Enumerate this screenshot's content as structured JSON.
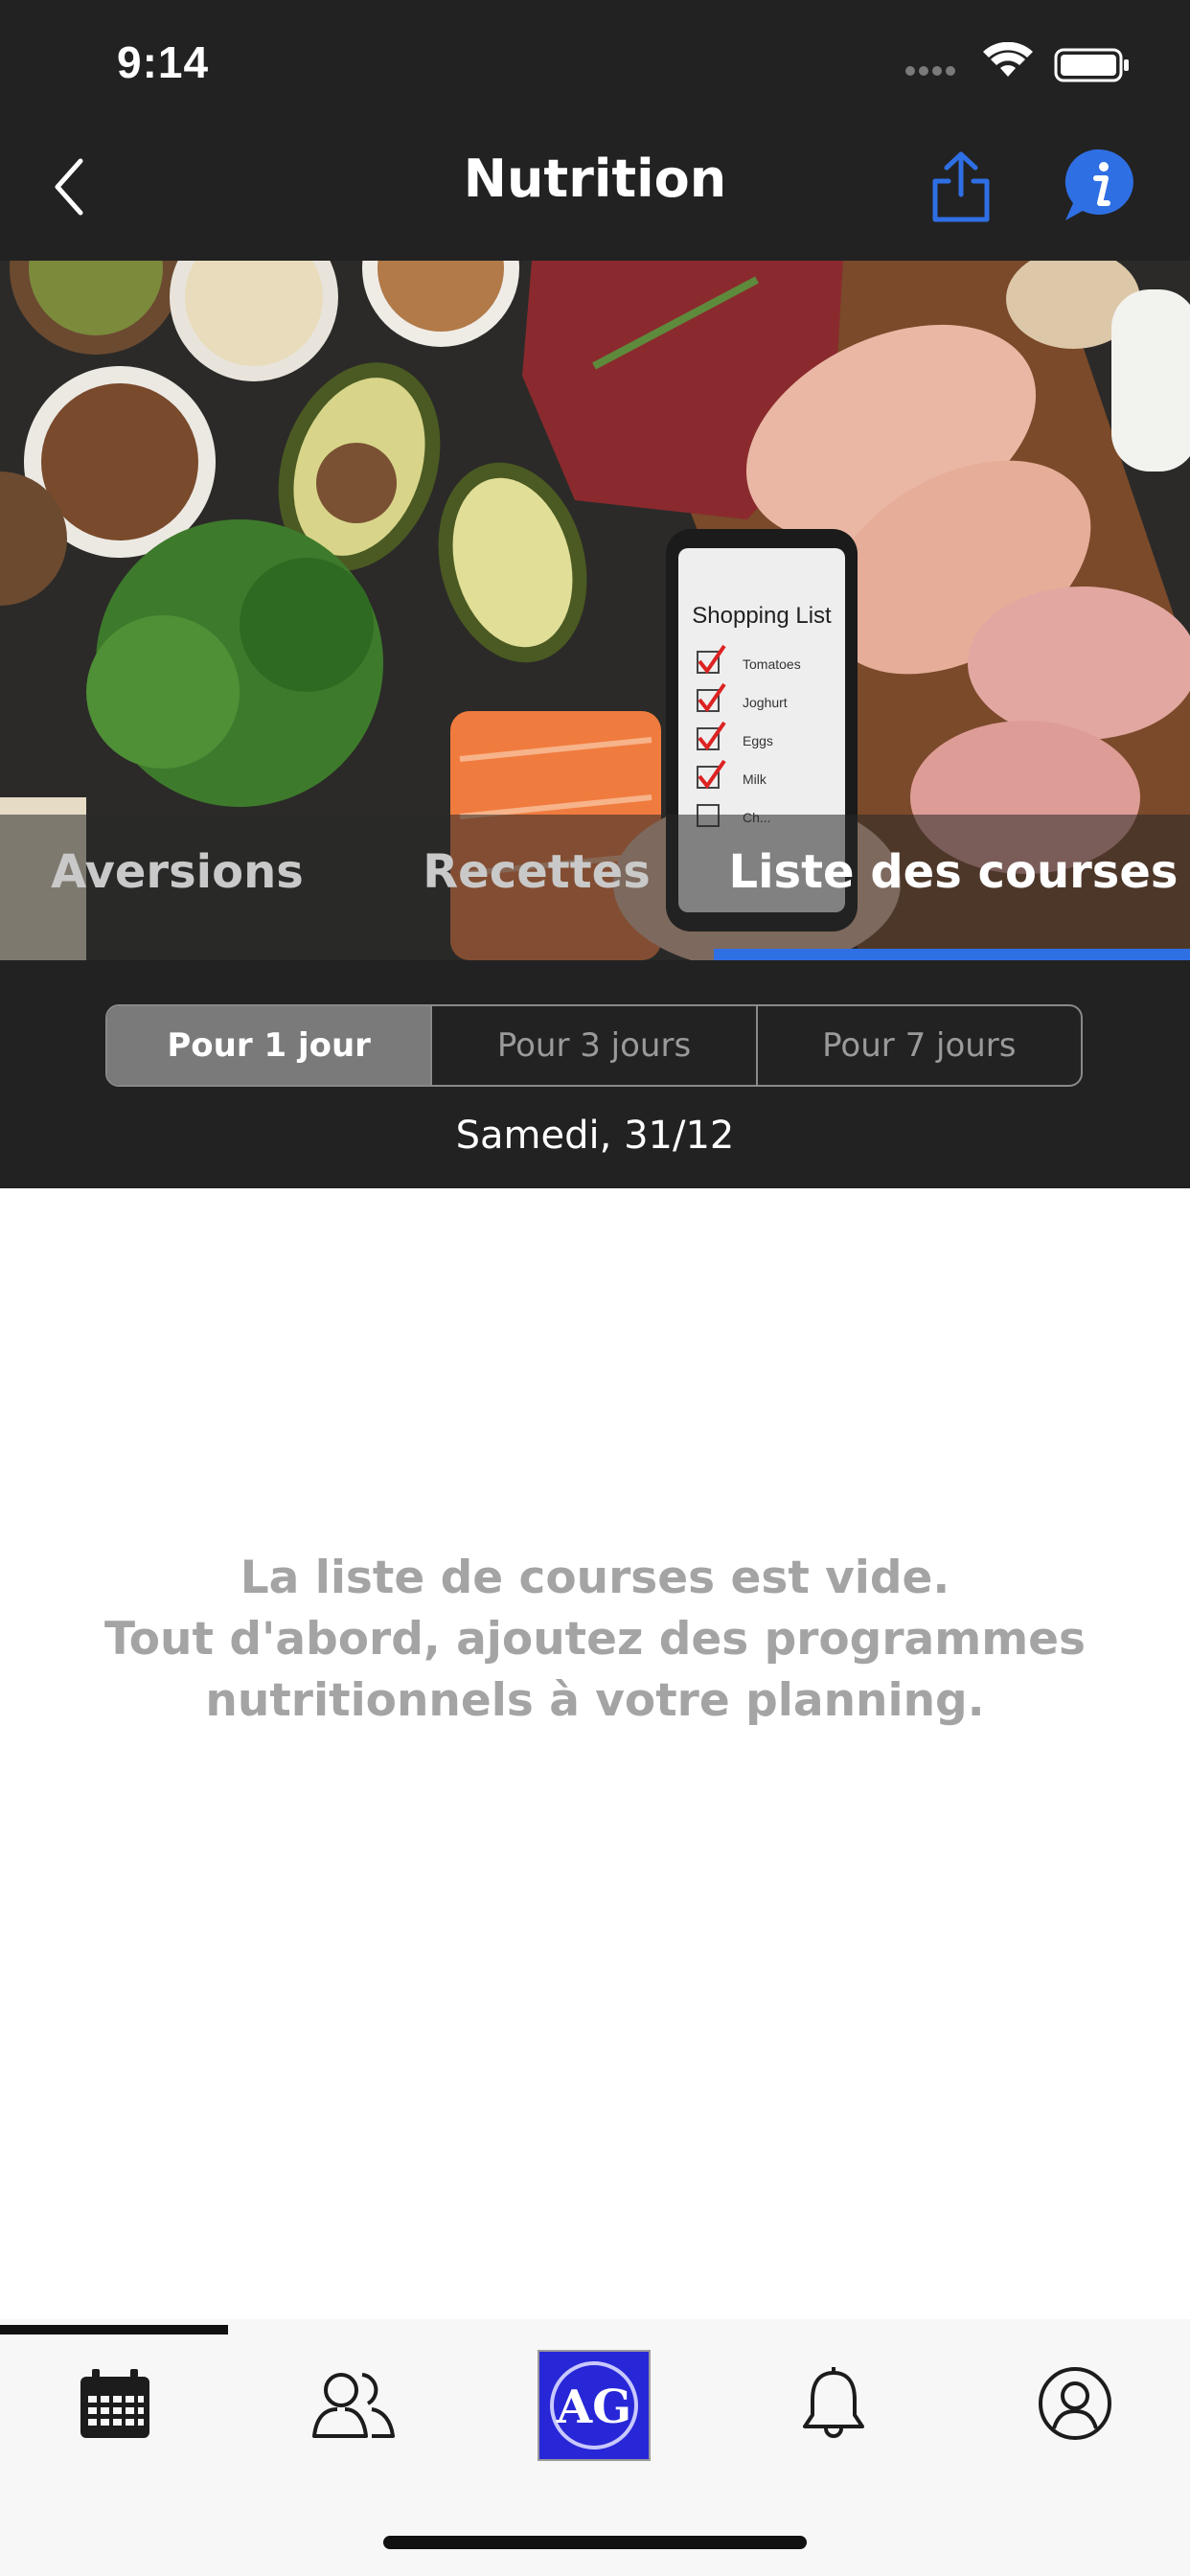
{
  "status_bar": {
    "time": "9:14"
  },
  "nav": {
    "title": "Nutrition",
    "back_icon": "chevron-left-icon",
    "share_icon": "share-icon",
    "info_icon": "info-bubble-icon",
    "accent_color": "#2f6fe4"
  },
  "hero": {
    "phone_screen_text": "Shopping List",
    "phone_items": [
      "Tomatoes",
      "Joghurt",
      "Eggs",
      "Milk",
      "Ch..."
    ]
  },
  "tabs": [
    {
      "label": "Aversions",
      "active": false
    },
    {
      "label": "Recettes",
      "active": false
    },
    {
      "label": "Liste des courses",
      "active": true
    }
  ],
  "period_selector": {
    "options": [
      "Pour 1 jour",
      "Pour 3 jours",
      "Pour 7 jours"
    ],
    "selected": "Pour 1 jour"
  },
  "date": "Samedi, 31/12",
  "empty_state": {
    "line1": "La liste de courses est vide.",
    "line2": "Tout d'abord, ajoutez des programmes",
    "line3": "nutritionnels à votre planning."
  },
  "tabbar": {
    "items": [
      "calendar-icon",
      "users-icon",
      "app-logo",
      "bell-icon",
      "profile-icon"
    ],
    "active_index": 0
  }
}
